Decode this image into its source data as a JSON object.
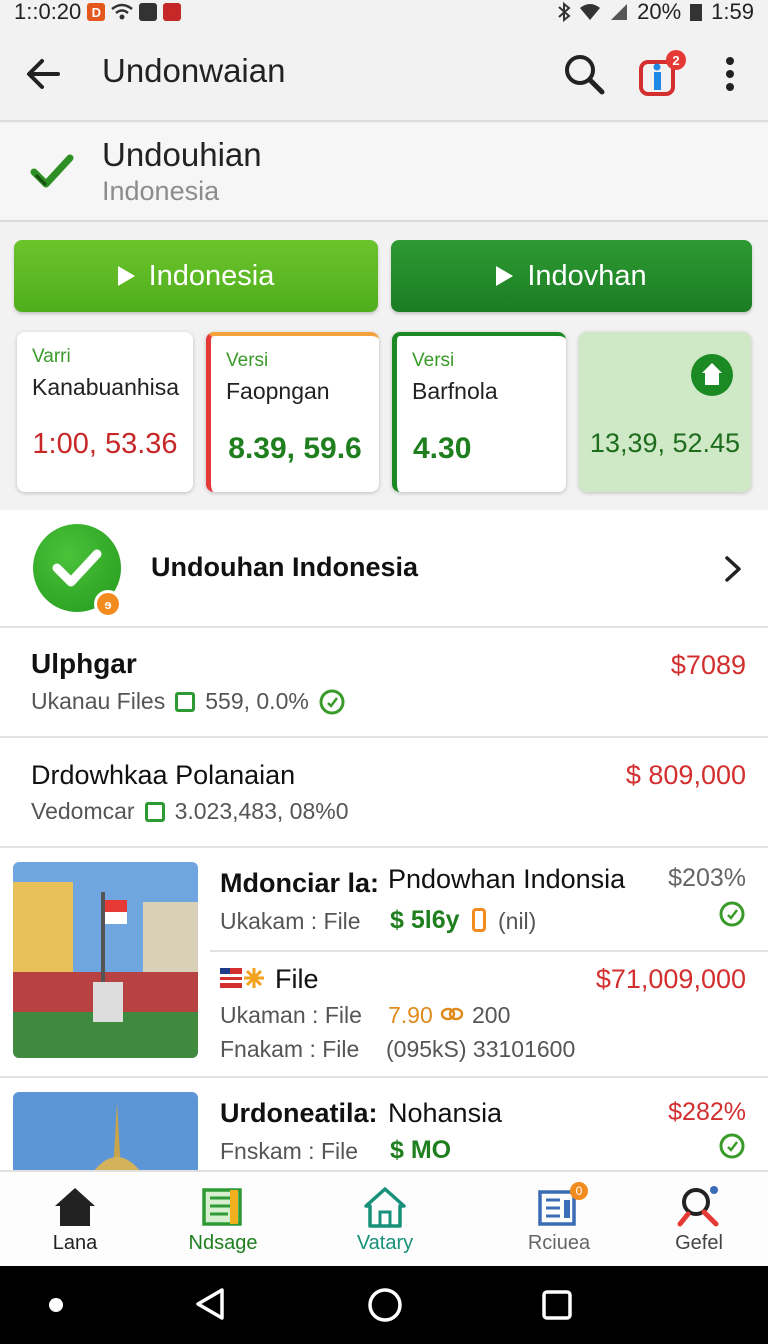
{
  "status_bar": {
    "time_left": "1::0:20",
    "battery": "20%",
    "clock": "1:59",
    "badge_d": "D"
  },
  "app_bar": {
    "title": "Undonwaian",
    "notification_count": "2"
  },
  "header": {
    "name": "Undouhian",
    "subtitle": "Indonesia"
  },
  "buttons": {
    "primary": "Indonesia",
    "secondary": "Indovhan"
  },
  "cards": [
    {
      "label": "Varri",
      "name": "Kanabuanhisa",
      "value": "1:00, 53.36"
    },
    {
      "label": "Versi",
      "name": "Faopngan",
      "value": "8.39, 59.6"
    },
    {
      "label": "Versi",
      "name": "Barfnola",
      "value": "4.30"
    },
    {
      "value": "13,39, 52.45"
    }
  ],
  "hero": {
    "title": "Undouhan Indonesia",
    "badge": "ɘ"
  },
  "items": [
    {
      "title": "Ulphgar",
      "sub": "Ukanau Files",
      "stat": "559, 0.0%",
      "price": "$7089"
    },
    {
      "title": "Drdowhkaa Polanaian",
      "sub": "Vedomcar",
      "stat": "3.023,483, 08%0",
      "price": "$ 809,000"
    }
  ],
  "media_items": [
    {
      "title_a": "Mdonciar la:",
      "title_b": "Pndowhan Indonsia",
      "pct": "$203%",
      "line1_label": "Ukakam : File",
      "line1_value": "$ 5l6y",
      "line1_extra": "(nil)",
      "row2_title": "File",
      "row2_price": "$71,009,000",
      "row2_line1_label": "Ukaman : File",
      "row2_line1_value": "7.90",
      "row2_line1_extra": "200",
      "row2_line2_label": "Fnakam : File",
      "row2_line2_value": "(095kS) 3310160​0"
    },
    {
      "title_a": "Urdoneatila:",
      "title_b": "Nohansia",
      "pct": "$282%",
      "line1_label": "Fnskam : File",
      "line1_value": "$ MO"
    }
  ],
  "bottom_nav": [
    {
      "label": "Lana",
      "icon": "home-icon"
    },
    {
      "label": "Ndsage",
      "icon": "map-book-icon"
    },
    {
      "label": "Vatary",
      "icon": "house-outline-icon"
    },
    {
      "label": "Rciuea",
      "icon": "news-icon",
      "badge": "0"
    },
    {
      "label": "Gefel",
      "icon": "search-person-icon"
    }
  ],
  "colors": {
    "accent_green": "#4fae1c",
    "dark_green": "#1b7d22",
    "price_red": "#d32f2f"
  }
}
